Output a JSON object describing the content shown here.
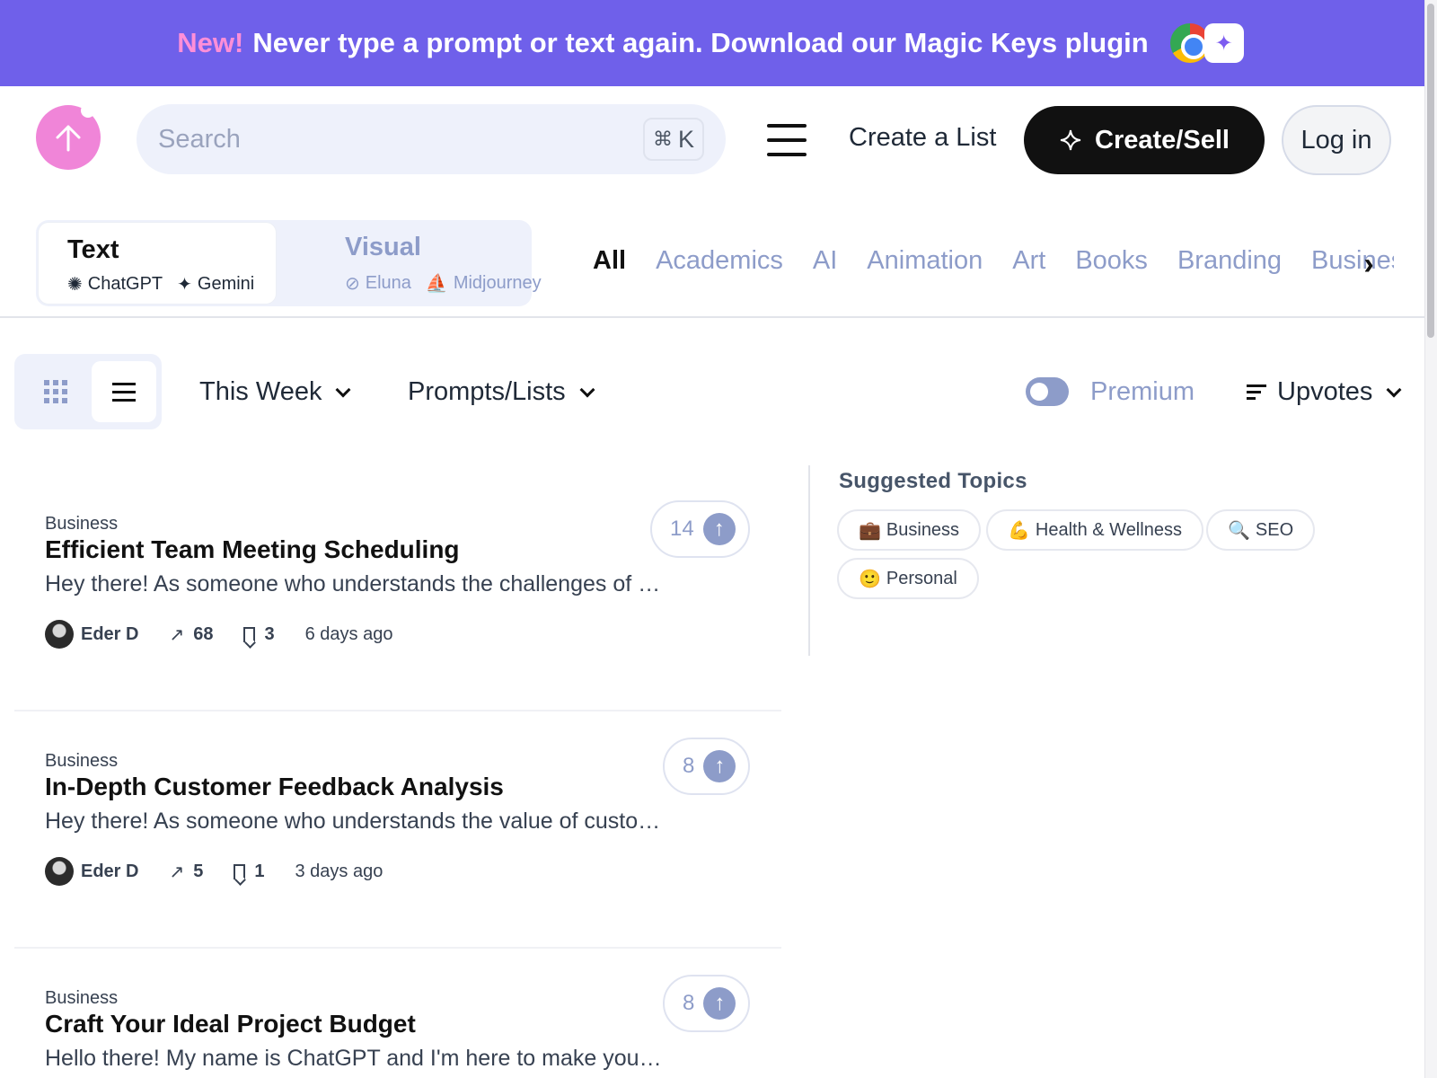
{
  "banner": {
    "new_label": "New!",
    "message": "Never type a prompt or text again. Download our Magic Keys plugin",
    "icons": [
      "chrome-icon",
      "magic-wand-icon"
    ],
    "bg_color": "#6f60ea"
  },
  "header": {
    "search_placeholder": "Search",
    "search_shortcut_key": "K",
    "search_shortcut_symbol": "⌘",
    "create_list_label": "Create a List",
    "create_sell_label": "Create/Sell",
    "login_label": "Log in"
  },
  "model_switcher": {
    "text": {
      "title": "Text",
      "models": [
        "ChatGPT",
        "Gemini"
      ]
    },
    "visual": {
      "title": "Visual",
      "models": [
        "Eluna",
        "Midjourney"
      ]
    }
  },
  "categories": [
    "All",
    "Academics",
    "AI",
    "Animation",
    "Art",
    "Books",
    "Branding",
    "Business"
  ],
  "filters": {
    "period": "This Week",
    "content_type": "Prompts/Lists",
    "premium_label": "Premium",
    "premium_enabled": false,
    "sort": "Upvotes"
  },
  "feed": [
    {
      "category": "Business",
      "title": "Efficient Team Meeting Scheduling",
      "description": "Hey there! As someone who understands the challenges of …",
      "author": "Eder D",
      "views": "68",
      "saves": "3",
      "time": "6 days ago",
      "upvotes": "14"
    },
    {
      "category": "Business",
      "title": "In-Depth Customer Feedback Analysis",
      "description": "Hey there! As someone who understands the value of custom…",
      "author": "Eder D",
      "views": "5",
      "saves": "1",
      "time": "3 days ago",
      "upvotes": "8"
    },
    {
      "category": "Business",
      "title": "Craft Your Ideal Project Budget",
      "description": "Hello there! My name is ChatGPT and I'm here to make your p…",
      "author": "",
      "views": "",
      "saves": "",
      "time": "",
      "upvotes": "8"
    }
  ],
  "suggested_topics": {
    "title": "Suggested Topics",
    "topics": [
      {
        "emoji": "💼",
        "label": "Business"
      },
      {
        "emoji": "💪",
        "label": "Health & Wellness"
      },
      {
        "emoji": "🔍",
        "label": "SEO"
      },
      {
        "emoji": "🙂",
        "label": "Personal"
      }
    ]
  },
  "colors": {
    "accent_pink": "#f085d8",
    "muted_blue": "#8d9cc9",
    "primary_button": "#111111"
  }
}
